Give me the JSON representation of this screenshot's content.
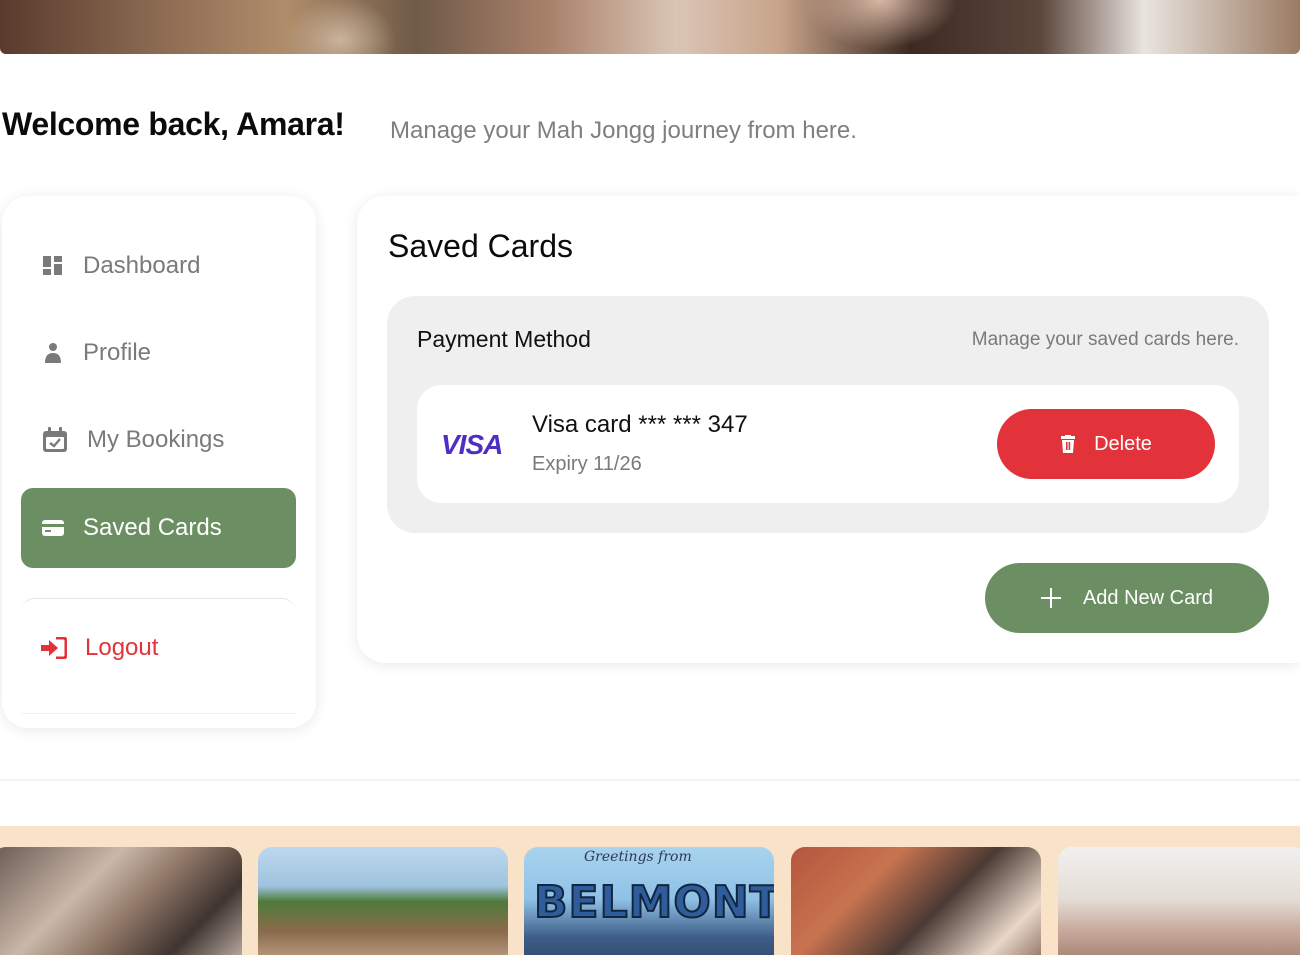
{
  "header": {
    "welcome_title": "Welcome back, Amara!",
    "welcome_subtitle": "Manage your Mah Jongg journey from here."
  },
  "sidebar": {
    "items": [
      {
        "label": "Dashboard",
        "icon": "dashboard-icon"
      },
      {
        "label": "Profile",
        "icon": "user-icon"
      },
      {
        "label": "My Bookings",
        "icon": "calendar-check-icon"
      },
      {
        "label": "Saved Cards",
        "icon": "credit-card-icon",
        "active": true
      },
      {
        "label": "Logout",
        "icon": "sign-in-icon"
      }
    ]
  },
  "main": {
    "title": "Saved Cards",
    "payment": {
      "title": "Payment Method",
      "subtitle": "Manage your saved cards here.",
      "cards": [
        {
          "brand": "VISA",
          "name": "Visa card *** *** 347",
          "expiry": "Expiry 11/26"
        }
      ],
      "delete_label": "Delete"
    },
    "add_label": "Add New Card"
  },
  "gallery": {
    "postcard_script": "Greetings from",
    "postcard_text": "BELMONT"
  },
  "colors": {
    "accent_green": "#6b8f62",
    "danger_red": "#e2323a",
    "gallery_band": "#f8e3c8",
    "visa_purple": "#4e2ec3"
  }
}
